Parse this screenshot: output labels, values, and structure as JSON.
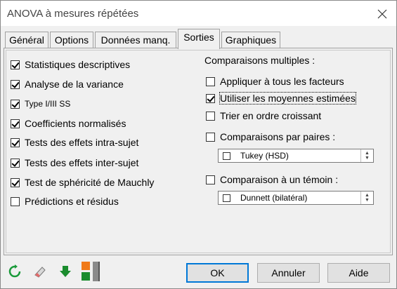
{
  "window": {
    "title": "ANOVA à mesures répétées"
  },
  "tabs": [
    {
      "label": "Général"
    },
    {
      "label": "Options"
    },
    {
      "label": "Données manq."
    },
    {
      "label": "Sorties"
    },
    {
      "label": "Graphiques"
    }
  ],
  "active_tab": "Sorties",
  "left_options": [
    {
      "label": "Statistiques descriptives",
      "checked": true
    },
    {
      "label": "Analyse de la variance",
      "checked": true
    },
    {
      "label": "Type I/III SS",
      "checked": true
    },
    {
      "label": "Coefficients normalisés",
      "checked": true
    },
    {
      "label": "Tests des effets intra-sujet",
      "checked": true
    },
    {
      "label": "Tests des effets inter-sujet",
      "checked": true
    },
    {
      "label": "Test de sphéricité de Mauchly",
      "checked": true
    },
    {
      "label": "Prédictions et résidus",
      "checked": false
    }
  ],
  "multiple_comparisons": {
    "heading": "Comparaisons multiples :",
    "options": [
      {
        "label": "Appliquer à tous les facteurs",
        "checked": false
      },
      {
        "label": "Utiliser les moyennes estimées",
        "checked": true
      },
      {
        "label": "Trier en ordre croissant",
        "checked": false
      }
    ],
    "pairwise": {
      "label": "Comparaisons par paires :",
      "checked": false,
      "method": "Tukey (HSD)"
    },
    "control": {
      "label": "Comparaison à un témoin :",
      "checked": false,
      "method": "Dunnett (bilatéral)"
    }
  },
  "buttons": {
    "ok": "OK",
    "cancel": "Annuler",
    "help": "Aide"
  },
  "icons": {
    "reset": "refresh-icon",
    "clear": "eraser-icon",
    "download": "down-arrow-icon",
    "layout": "layout-icon"
  },
  "colors": {
    "focus_border": "#0078d7",
    "refresh_green": "#1a9a3a",
    "arrow_green": "#1b8c2e",
    "layout_orange": "#f07a1a"
  }
}
